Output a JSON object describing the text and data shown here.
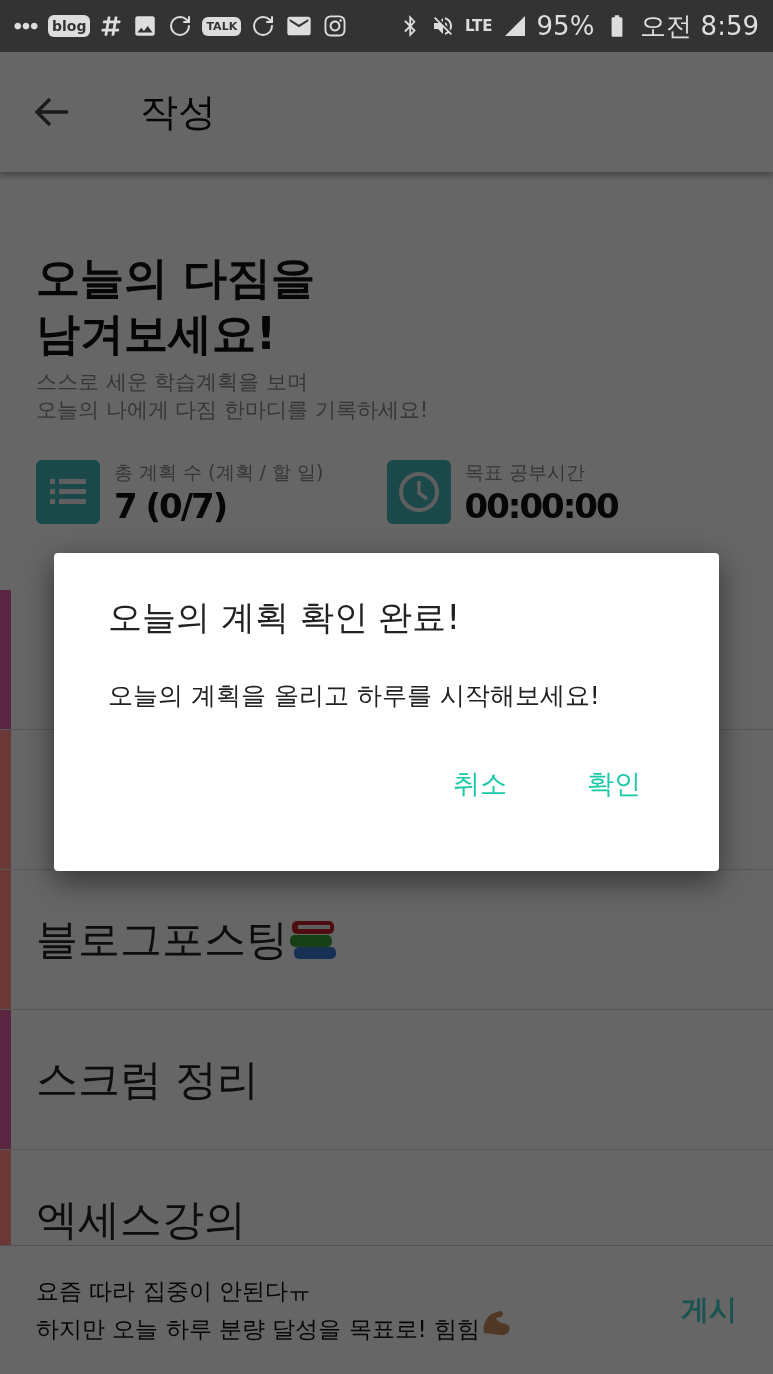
{
  "status_bar": {
    "blog_badge": "blog",
    "talk_badge": "TALK",
    "network": "LTE",
    "battery": "95%",
    "time": "오전 8:59"
  },
  "app_bar": {
    "title": "작성"
  },
  "header": {
    "title_lines": [
      "오늘의 다짐을",
      "남겨보세요!"
    ],
    "subtitle_lines": [
      "스스로 세운 학습계획을 보며",
      "오늘의 나에게 다짐 한마디를 기록하세요!"
    ]
  },
  "stats": [
    {
      "kind": "list",
      "label": "총 계획 수 (계획 / 할 일)",
      "value": "7 (0/7)"
    },
    {
      "kind": "clock",
      "label": "목표 공부시간",
      "value": "00:00:00"
    }
  ],
  "plans": [
    {
      "color": "#5a2540",
      "books_icon": false
    },
    {
      "color": "#6b3838",
      "books_icon": false
    },
    {
      "color": "#6b3838",
      "text": "블로그포스팅",
      "books_icon": true
    },
    {
      "color": "#5a2540",
      "text": "스크럼 정리",
      "books_icon": false
    },
    {
      "color": "#6b3838",
      "text": "엑세스강의",
      "books_icon": false
    }
  ],
  "composer": {
    "lines": [
      "요즘 따라 집중이 안된다ㅠ",
      "하지만 오늘 하루 분량 달성을 목표로! 힘힘"
    ],
    "arm_icon": true,
    "post": "게시"
  },
  "dialog": {
    "title": "오늘의 계획 확인 완료!",
    "message": "오늘의 계획을 올리고 하루를 시작해보세요!",
    "buttons": [
      "취소",
      "확인"
    ]
  }
}
